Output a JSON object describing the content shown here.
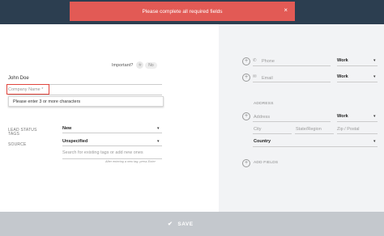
{
  "toast": {
    "message": "Please complete all required fields",
    "close": "×"
  },
  "left": {
    "important_label": "Important?",
    "important_star": "★",
    "important_value": "No",
    "name_value": "John Doe",
    "company_label": "Company Name *",
    "company_error": "Please enter 3 or more characters",
    "lead_status_label": "LEAD STATUS",
    "lead_status_value": "New",
    "source_label": "SOURCE",
    "source_value": "Unspecified",
    "tags_label": "TAGS",
    "tags_placeholder": "Search for existing tags or add new ones",
    "tags_hint": "After entering a new tag, press Enter",
    "dropdown_arrow": "▾"
  },
  "right": {
    "plus": "+",
    "phone_icon": "✆",
    "phone_placeholder": "Phone",
    "phone_type": "Work",
    "email_icon": "✉",
    "email_placeholder": "Email",
    "email_type": "Work",
    "address_heading": "ADDRESS",
    "address_placeholder": "Address",
    "address_type": "Work",
    "city_placeholder": "City",
    "state_placeholder": "State/Region",
    "zip_placeholder": "Zip / Postal",
    "country_placeholder": "Country",
    "add_fields": "ADD FIELDS",
    "dropdown_arrow": "▾"
  },
  "footer": {
    "check": "✔",
    "save_label": "SAVE"
  }
}
